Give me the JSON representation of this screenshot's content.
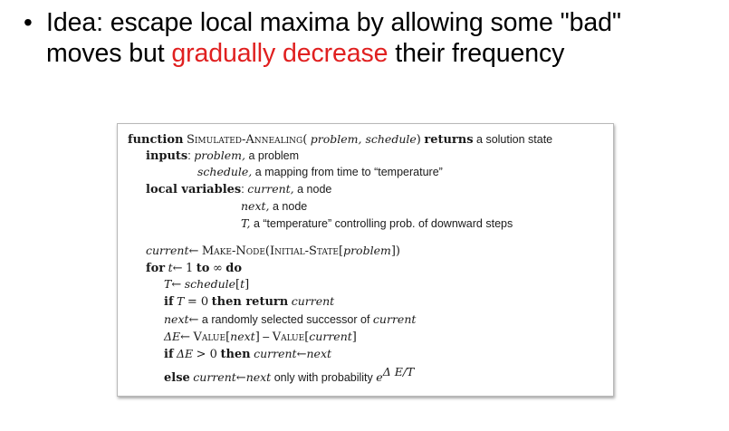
{
  "bullet": {
    "symbol": "•",
    "line1": "Idea: escape local maxima by allowing some \"bad\"",
    "line2_pre": "moves but ",
    "line2_highlight": "gradually decrease",
    "line2_post": " their frequency",
    "highlight_color": "#e02020"
  },
  "algorithm": {
    "l1": {
      "kw1": "function",
      "name_caps": "Simulated-Annealing",
      "paren_open": "(",
      "args": "problem, schedule",
      "paren_close": ")",
      "kw2": "returns",
      "tail": "a solution state"
    },
    "l2": {
      "kw": "inputs",
      "colon": ":",
      "var": "problem,",
      "text": "a problem"
    },
    "l3": {
      "var": "schedule,",
      "text": "a mapping from time to “temperature”"
    },
    "l4": {
      "kw": "local variables",
      "colon": ":",
      "var": "current,",
      "text": "a node"
    },
    "l5": {
      "var": "next,",
      "text": "a node"
    },
    "l6": {
      "var": "T,",
      "text": "a “temperature” controlling prob. of downward steps"
    },
    "l7": {
      "var": "current",
      "arrow": "←",
      "fn": "Make-Node",
      "bo": "(",
      "fn2": "Initial-State",
      "lb": "[",
      "arg": "problem",
      "rb": "]",
      "bc": ")"
    },
    "l8": {
      "kw1": "for",
      "var": "t",
      "arrow": "←",
      "mid": "1",
      "kw2": "to",
      "inf": "∞",
      "kw3": "do"
    },
    "l9": {
      "var": "T",
      "arrow": "←",
      "fn": "schedule",
      "lb": "[",
      "arg": "t",
      "rb": "]"
    },
    "l10": {
      "kw1": "if",
      "var": "T",
      "eq": "= 0",
      "kw2": "then return",
      "val": "current"
    },
    "l11": {
      "var": "next",
      "arrow": "←",
      "text": "a randomly selected successor of",
      "val": "current"
    },
    "l12": {
      "lhs": "ΔE",
      "arrow": "←",
      "fn1": "Value",
      "lb1": "[",
      "a1": "next",
      "rb1": "]",
      "minus": "–",
      "fn2": "Value",
      "lb2": "[",
      "a2": "current",
      "rb2": "]"
    },
    "l13": {
      "kw1": "if",
      "lhs": "ΔE",
      "cmp": "> 0",
      "kw2": "then",
      "var": "current",
      "arrow": "←",
      "val": "next"
    },
    "l14": {
      "kw": "else",
      "var": "current",
      "arrow": "←",
      "val": "next",
      "text": "only with probability",
      "base": "e",
      "exp": "Δ E/T"
    }
  }
}
